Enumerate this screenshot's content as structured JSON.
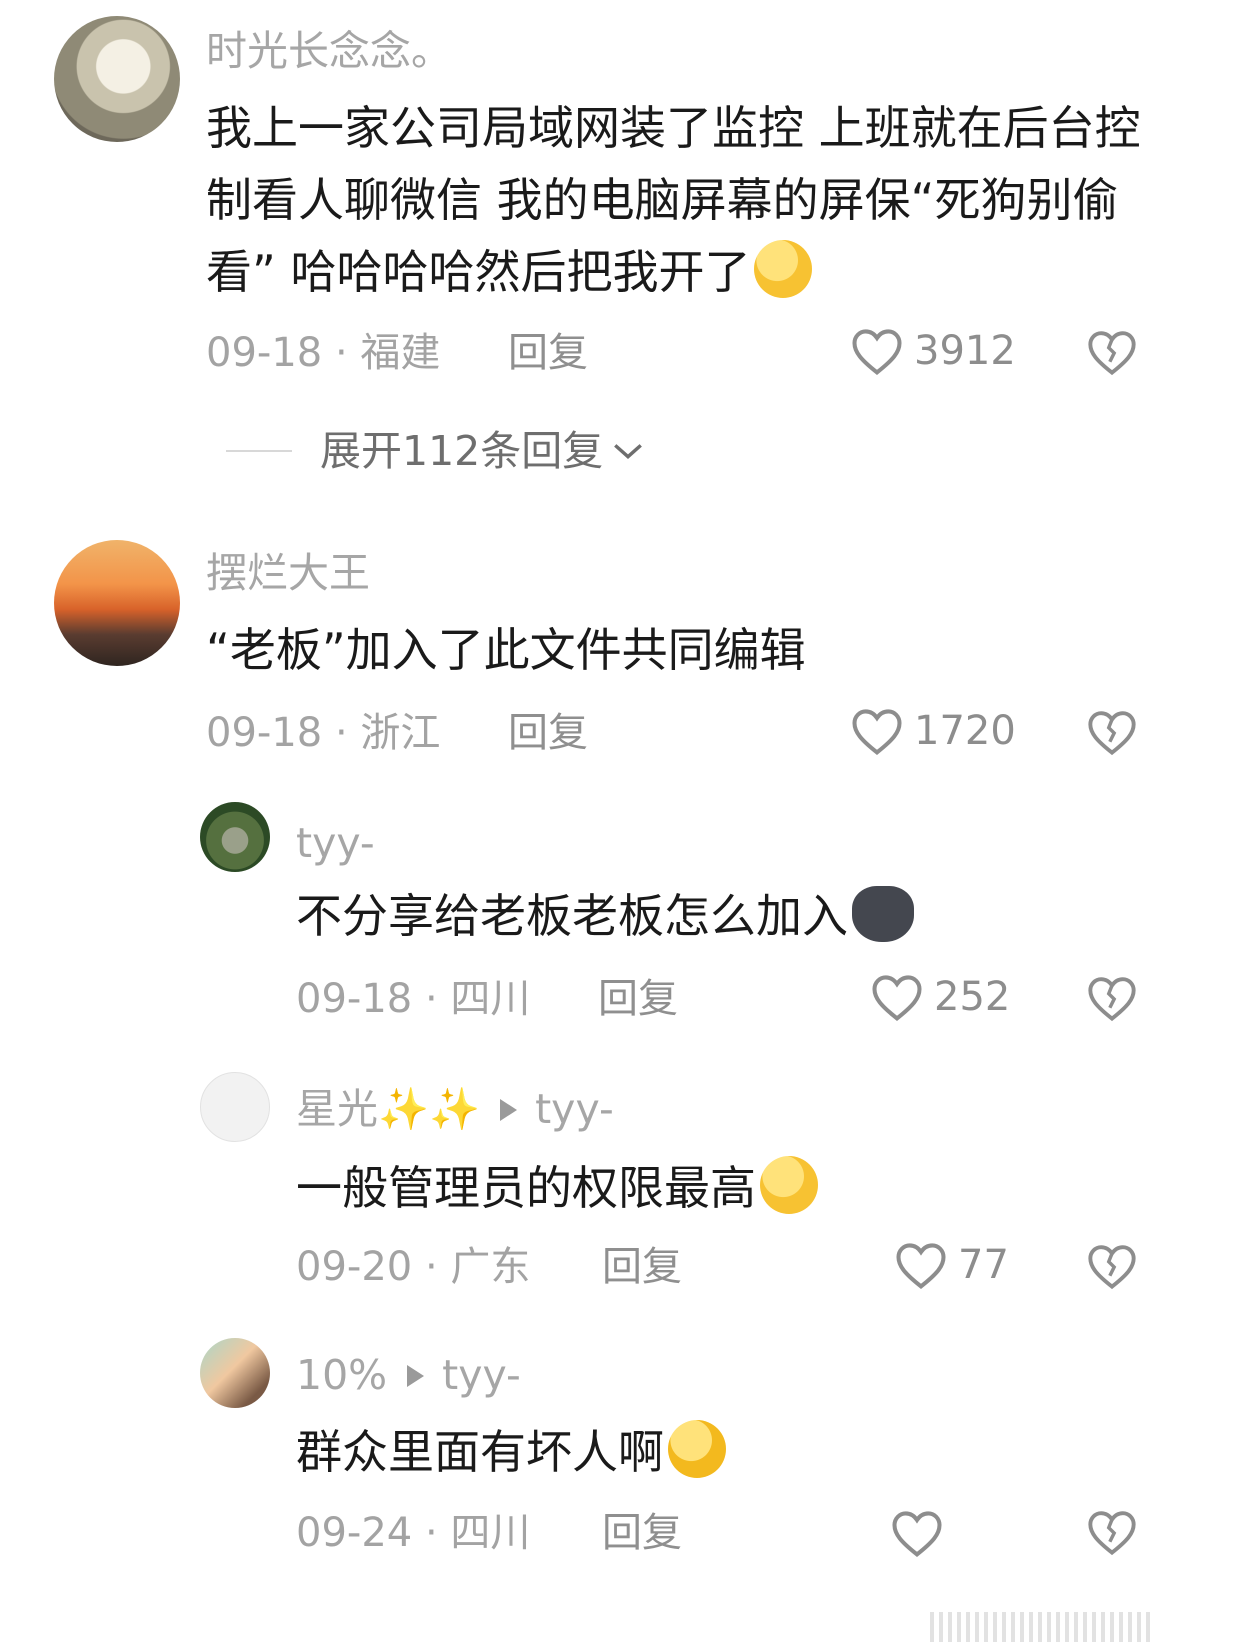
{
  "comments": [
    {
      "name": "时光长念念。",
      "text": "我上一家公司局域网装了监控 上班就在后台控制看人聊微信 我的电脑屏幕的屏保“死狗别偷看” 哈哈哈哈然后把我开了",
      "emoji": "shushing-face-icon",
      "date": "09-18",
      "location": "福建",
      "reply_label": "回复",
      "likes": "3912"
    },
    {
      "name": "摆烂大王",
      "text": "“老板”加入了此文件共同编辑",
      "date": "09-18",
      "location": "浙江",
      "reply_label": "回复",
      "likes": "1720"
    }
  ],
  "expand_replies": "展开112条回复",
  "replies": [
    {
      "name": "tyy-",
      "text": "不分享给老板老板怎么加入",
      "emoji": "husky-face-icon",
      "date": "09-18",
      "location": "四川",
      "reply_label": "回复",
      "likes": "252"
    },
    {
      "name": "星光",
      "name_sparkles": "✨✨",
      "reply_to": "tyy-",
      "text": "一般管理员的权限最高",
      "emoji": "thinking-smirk-icon",
      "date": "09-20",
      "location": "广东",
      "reply_label": "回复",
      "likes": "77"
    },
    {
      "name": "10%",
      "reply_to": "tyy-",
      "text": "群众里面有坏人啊",
      "emoji": "crying-face-icon",
      "date": "09-24",
      "location": "四川",
      "reply_label": "回复",
      "likes": ""
    }
  ],
  "colors": {
    "name": "#a6a6a6",
    "text": "#1a1a1a",
    "meta": "#a3a3a3",
    "icon": "#8d8d8d"
  }
}
